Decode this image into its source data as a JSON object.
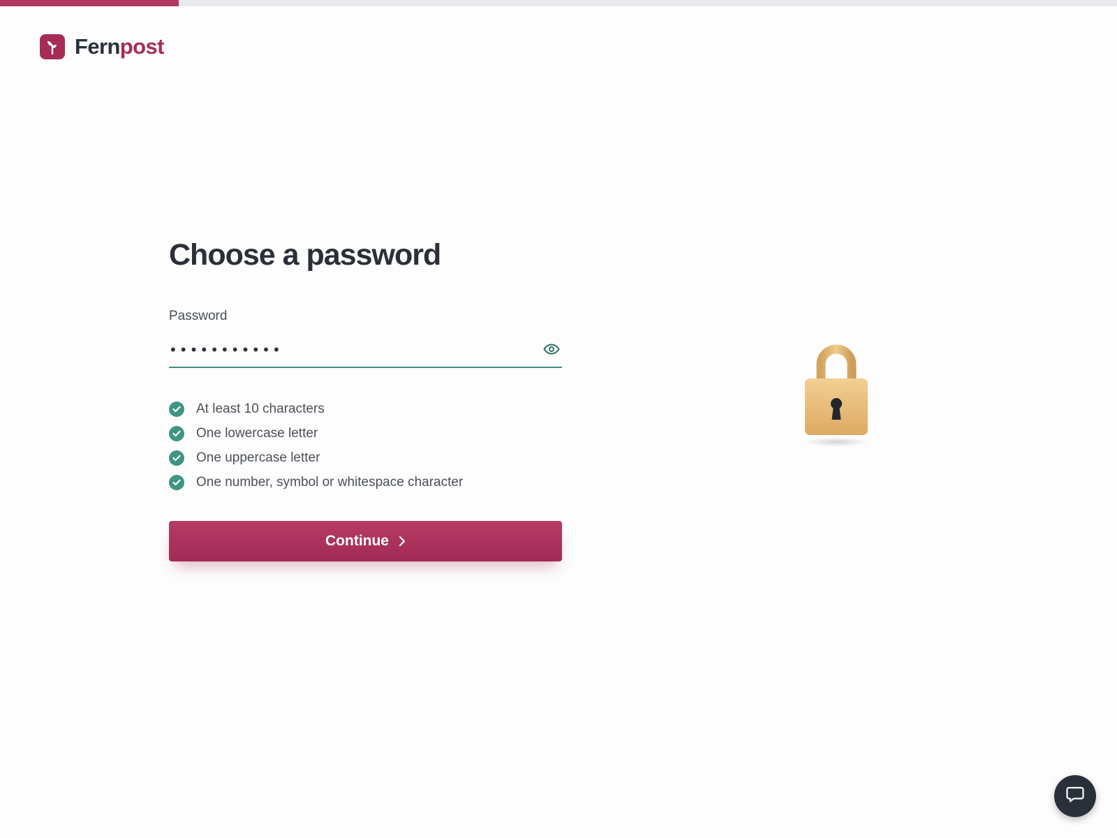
{
  "progress": {
    "fraction": 0.16,
    "color": "#b2395f"
  },
  "brand": {
    "name_part1": "Fern",
    "name_part2": "post",
    "icon": "sprout-icon",
    "color": "#a62c54"
  },
  "page": {
    "title": "Choose a password"
  },
  "password_field": {
    "label": "Password",
    "value": "•••••••••••",
    "toggle_icon": "eye-icon",
    "accent": "#3f8c7f"
  },
  "requirements": [
    {
      "text": "At least 10 characters",
      "met": true
    },
    {
      "text": "One lowercase letter",
      "met": true
    },
    {
      "text": "One uppercase letter",
      "met": true
    },
    {
      "text": "One number, symbol or whitespace character",
      "met": true
    }
  ],
  "continue_button": {
    "label": "Continue",
    "icon": "chevron-right-icon",
    "color": "#a62c54"
  },
  "illustration": {
    "icon": "padlock-icon"
  },
  "chat": {
    "icon": "chat-bubble-icon"
  }
}
